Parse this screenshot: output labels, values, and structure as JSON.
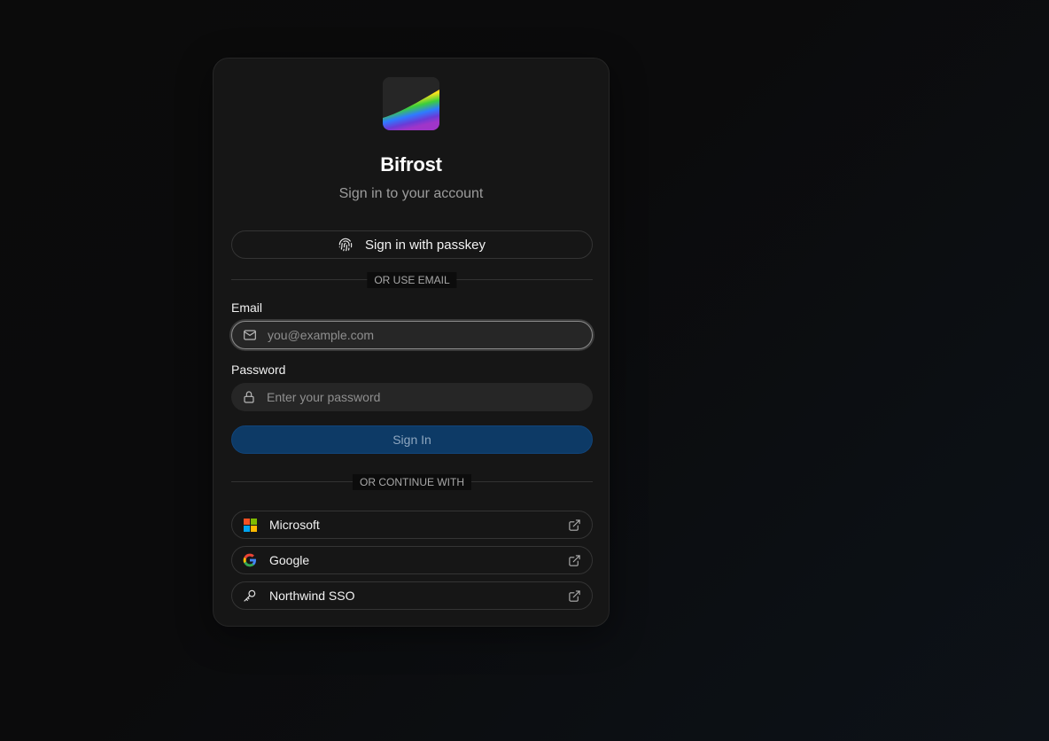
{
  "app": {
    "name": "Bifrost",
    "subtitle": "Sign in to your account"
  },
  "passkey": {
    "label": "Sign in with passkey",
    "icon": "fingerprint-icon"
  },
  "email_divider": "OR USE EMAIL",
  "email": {
    "label": "Email",
    "placeholder": "you@example.com",
    "value": "",
    "icon": "mail-icon"
  },
  "password": {
    "label": "Password",
    "placeholder": "Enter your password",
    "value": "",
    "icon": "lock-icon"
  },
  "signin": {
    "label": "Sign In",
    "color": "#0d3a66"
  },
  "continue_divider": "OR CONTINUE WITH",
  "providers": [
    {
      "label": "Microsoft",
      "icon": "microsoft-logo-icon"
    },
    {
      "label": "Google",
      "icon": "google-logo-icon"
    },
    {
      "label": "Northwind SSO",
      "icon": "key-icon"
    }
  ],
  "colors": {
    "background": "#0b0b0b",
    "card": "#161616",
    "accent": "#0d3a66"
  }
}
